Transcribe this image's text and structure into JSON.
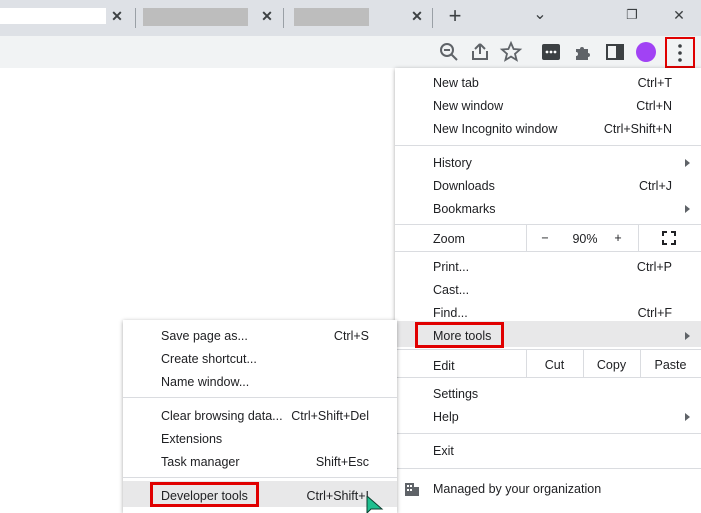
{
  "tabs": {
    "close_glyph": "✕",
    "new_tab_glyph": "+"
  },
  "window_controls": {
    "chevron": "⌄",
    "restore": "❐",
    "close": "✕"
  },
  "menu": {
    "new_tab": {
      "label": "New tab",
      "shortcut": "Ctrl+T"
    },
    "new_window": {
      "label": "New window",
      "shortcut": "Ctrl+N"
    },
    "new_incognito": {
      "label": "New Incognito window",
      "shortcut": "Ctrl+Shift+N"
    },
    "history": {
      "label": "History"
    },
    "downloads": {
      "label": "Downloads",
      "shortcut": "Ctrl+J"
    },
    "bookmarks": {
      "label": "Bookmarks"
    },
    "zoom": {
      "label": "Zoom",
      "minus": "−",
      "value": "90%",
      "plus": "+"
    },
    "print": {
      "label": "Print...",
      "shortcut": "Ctrl+P"
    },
    "cast": {
      "label": "Cast..."
    },
    "find": {
      "label": "Find...",
      "shortcut": "Ctrl+F"
    },
    "more_tools": {
      "label": "More tools"
    },
    "edit": {
      "label": "Edit",
      "cut": "Cut",
      "copy": "Copy",
      "paste": "Paste"
    },
    "settings": {
      "label": "Settings"
    },
    "help": {
      "label": "Help"
    },
    "exit": {
      "label": "Exit"
    },
    "managed": {
      "label": "Managed by your organization"
    }
  },
  "submenu": {
    "save_page": {
      "label": "Save page as...",
      "shortcut": "Ctrl+S"
    },
    "create_shortcut": {
      "label": "Create shortcut..."
    },
    "name_window": {
      "label": "Name window..."
    },
    "clear_browsing": {
      "label": "Clear browsing data...",
      "shortcut": "Ctrl+Shift+Del"
    },
    "extensions": {
      "label": "Extensions"
    },
    "task_manager": {
      "label": "Task manager",
      "shortcut": "Shift+Esc"
    },
    "developer_tools": {
      "label": "Developer tools",
      "shortcut": "Ctrl+Shift+I"
    }
  },
  "colors": {
    "highlight_box": "#e00000",
    "avatar": "#a142f4",
    "cursor": "#1fbf8f"
  },
  "icons": [
    "zoom-out-icon",
    "share-icon",
    "star-icon",
    "extension-tile-icon",
    "puzzle-icon",
    "side-panel-icon",
    "avatar",
    "more-vert-icon",
    "building-icon",
    "cursor-icon"
  ]
}
